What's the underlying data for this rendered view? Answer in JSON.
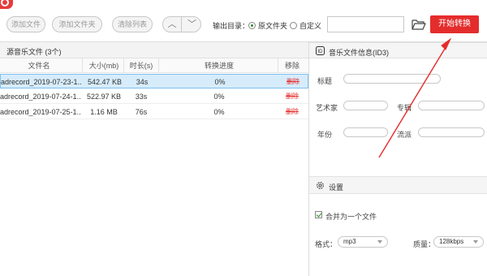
{
  "toolbar": {
    "add_file": "添加文件",
    "add_folder": "添加文件夹",
    "clear_list": "清除列表",
    "move_up_glyph": "︿",
    "move_down_glyph": "﹀",
    "output_dir_label": "输出目录：",
    "radio_original": "原文件夹",
    "radio_custom": "自定义",
    "output_path_value": "",
    "start_button": "开始转换"
  },
  "file_list": {
    "header": "源音乐文件 (3个)",
    "columns": [
      "文件名",
      "大小(mb)",
      "时长(s)",
      "转换进度",
      "移除"
    ],
    "rows": [
      {
        "name": "adrecord_2019-07-23-1...",
        "size": "542.47 KB",
        "duration": "34s",
        "progress": "0%",
        "remove": "删除"
      },
      {
        "name": "adrecord_2019-07-24-1...",
        "size": "522.97 KB",
        "duration": "33s",
        "progress": "0%",
        "remove": "删除"
      },
      {
        "name": "adrecord_2019-07-25-1...",
        "size": "1.16 MB",
        "duration": "76s",
        "progress": "0%",
        "remove": "删除"
      }
    ]
  },
  "id3": {
    "header": "音乐文件信息(ID3)",
    "title_label": "标题",
    "artist_label": "艺术家",
    "album_label": "专辑",
    "year_label": "年份",
    "genre_label": "流派"
  },
  "settings": {
    "header": "设置",
    "merge_label": "合并为一个文件",
    "format_label": "格式：",
    "format_value": "mp3",
    "quality_label": "质量：",
    "quality_value": "128kbps"
  },
  "colors": {
    "accent_red": "#e52c2c",
    "selection_blue": "#d7ecfb"
  },
  "icons": [
    "logo-icon",
    "folder-open-icon",
    "id3-icon",
    "gear-icon",
    "checkbox-icon",
    "annotation-arrow"
  ]
}
